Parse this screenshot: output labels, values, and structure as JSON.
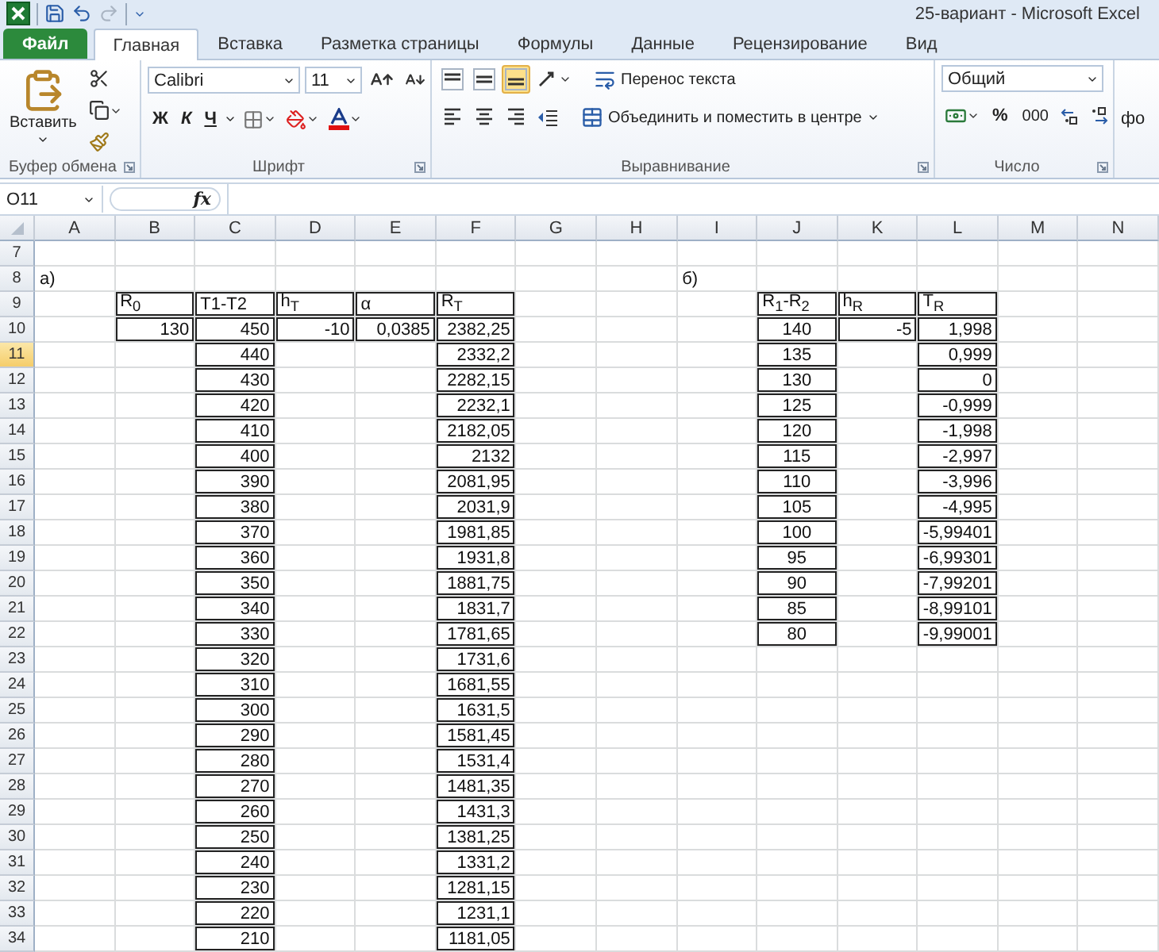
{
  "window": {
    "title": "25-вариант  -  Microsoft Excel"
  },
  "quick_access": [
    {
      "kind": "save",
      "disabled": false
    },
    {
      "kind": "undo",
      "disabled": false
    },
    {
      "kind": "redo",
      "disabled": true
    }
  ],
  "tabs": [
    {
      "label": "Файл",
      "kind": "file",
      "selected": false
    },
    {
      "label": "Главная",
      "kind": "normal",
      "selected": true
    },
    {
      "label": "Вставка",
      "kind": "normal",
      "selected": false
    },
    {
      "label": "Разметка страницы",
      "kind": "normal",
      "selected": false
    },
    {
      "label": "Формулы",
      "kind": "normal",
      "selected": false
    },
    {
      "label": "Данные",
      "kind": "normal",
      "selected": false
    },
    {
      "label": "Рецензирование",
      "kind": "normal",
      "selected": false
    },
    {
      "label": "Вид",
      "kind": "normal",
      "selected": false
    }
  ],
  "ribbon": {
    "clipboard": {
      "paste_label": "Вставить",
      "title": "Буфер обмена"
    },
    "font": {
      "name": "Calibri",
      "size": "11",
      "styles": [
        "Ж",
        "К",
        "Ч"
      ],
      "title": "Шрифт"
    },
    "alignment": {
      "vertical": [
        {
          "kind": "top",
          "selected": false
        },
        {
          "kind": "middle",
          "selected": false
        },
        {
          "kind": "bottom",
          "selected": true
        }
      ],
      "horizontal": [
        {
          "kind": "left",
          "selected": false
        },
        {
          "kind": "center",
          "selected": false
        },
        {
          "kind": "right",
          "selected": false
        }
      ],
      "wrap_label": "Перенос текста",
      "merge_label": "Объединить и поместить в центре",
      "title": "Выравнивание"
    },
    "number": {
      "format": "Общий",
      "percent": "%",
      "thousands": "000",
      "title": "Число"
    },
    "next_group": {
      "label": "фо"
    }
  },
  "formula_bar": {
    "name_box": "O11",
    "function_label": "fx"
  },
  "sheet": {
    "columns": [
      "A",
      "B",
      "C",
      "D",
      "E",
      "F",
      "G",
      "H",
      "I",
      "J",
      "K",
      "L",
      "M",
      "N"
    ],
    "rows": [
      {
        "number": "7",
        "selected": false,
        "cells": [
          {
            "kind": "empty",
            "boxed": false
          },
          {
            "kind": "empty",
            "boxed": false
          },
          {
            "kind": "empty",
            "boxed": false
          },
          {
            "kind": "empty",
            "boxed": false
          },
          {
            "kind": "empty",
            "boxed": false
          },
          {
            "kind": "empty",
            "boxed": false
          },
          {
            "kind": "empty",
            "boxed": false
          },
          {
            "kind": "empty",
            "boxed": false
          },
          {
            "kind": "empty",
            "boxed": false
          },
          {
            "kind": "empty",
            "boxed": false
          },
          {
            "kind": "empty",
            "boxed": false
          },
          {
            "kind": "empty",
            "boxed": false
          },
          {
            "kind": "empty",
            "boxed": false
          },
          {
            "kind": "empty",
            "boxed": false
          }
        ]
      },
      {
        "number": "8",
        "selected": false,
        "cells": [
          {
            "kind": "label",
            "text": "а)",
            "boxed": false
          },
          {
            "kind": "empty",
            "boxed": false
          },
          {
            "kind": "empty",
            "boxed": false
          },
          {
            "kind": "empty",
            "boxed": false
          },
          {
            "kind": "empty",
            "boxed": false
          },
          {
            "kind": "empty",
            "boxed": false
          },
          {
            "kind": "empty",
            "boxed": false
          },
          {
            "kind": "empty",
            "boxed": false
          },
          {
            "kind": "label",
            "text": "б)",
            "boxed": false
          },
          {
            "kind": "empty",
            "boxed": false
          },
          {
            "kind": "empty",
            "boxed": false
          },
          {
            "kind": "empty",
            "boxed": false
          },
          {
            "kind": "empty",
            "boxed": false
          },
          {
            "kind": "empty",
            "boxed": false
          }
        ]
      },
      {
        "number": "9",
        "selected": false,
        "cells": [
          {
            "kind": "empty",
            "boxed": false
          },
          {
            "kind": "label",
            "text": "R$_{0}$",
            "boxed": true
          },
          {
            "kind": "label",
            "text": "T1-T2",
            "boxed": true
          },
          {
            "kind": "label",
            "text": "h$_{T}$",
            "boxed": true
          },
          {
            "kind": "label",
            "text": "α",
            "boxed": true
          },
          {
            "kind": "label",
            "text": "R$_{T}$",
            "boxed": true
          },
          {
            "kind": "empty",
            "boxed": false
          },
          {
            "kind": "empty",
            "boxed": false
          },
          {
            "kind": "empty",
            "boxed": false
          },
          {
            "kind": "label",
            "text": "R$_{1}$-R$_{2}$",
            "boxed": true
          },
          {
            "kind": "label",
            "text": "h$_{R}$",
            "boxed": true
          },
          {
            "kind": "label",
            "text": "T$_{R}$",
            "boxed": true
          },
          {
            "kind": "empty",
            "boxed": false
          },
          {
            "kind": "empty",
            "boxed": false
          }
        ]
      },
      {
        "number": "10",
        "selected": false,
        "cells": [
          {
            "kind": "empty",
            "boxed": false
          },
          {
            "kind": "number",
            "text": "130",
            "boxed": true
          },
          {
            "kind": "number",
            "text": "450",
            "boxed": true
          },
          {
            "kind": "number",
            "text": "-10",
            "boxed": true
          },
          {
            "kind": "number",
            "text": "0,0385",
            "boxed": true
          },
          {
            "kind": "number",
            "text": "2382,25",
            "boxed": true
          },
          {
            "kind": "empty",
            "boxed": false
          },
          {
            "kind": "empty",
            "boxed": false
          },
          {
            "kind": "empty",
            "boxed": false
          },
          {
            "kind": "centered",
            "text": "140",
            "boxed": true
          },
          {
            "kind": "number",
            "text": "-5",
            "boxed": true
          },
          {
            "kind": "number",
            "text": "1,998",
            "boxed": true
          },
          {
            "kind": "empty",
            "boxed": false
          },
          {
            "kind": "empty",
            "boxed": false
          }
        ]
      },
      {
        "number": "11",
        "selected": true,
        "cells": [
          {
            "kind": "empty",
            "boxed": false
          },
          {
            "kind": "empty",
            "boxed": false
          },
          {
            "kind": "number",
            "text": "440",
            "boxed": true
          },
          {
            "kind": "empty",
            "boxed": false
          },
          {
            "kind": "empty",
            "boxed": false
          },
          {
            "kind": "number",
            "text": "2332,2",
            "boxed": true
          },
          {
            "kind": "empty",
            "boxed": false
          },
          {
            "kind": "empty",
            "boxed": false
          },
          {
            "kind": "empty",
            "boxed": false
          },
          {
            "kind": "centered",
            "text": "135",
            "boxed": true
          },
          {
            "kind": "empty",
            "boxed": false
          },
          {
            "kind": "number",
            "text": "0,999",
            "boxed": true
          },
          {
            "kind": "empty",
            "boxed": false
          },
          {
            "kind": "empty",
            "boxed": false
          }
        ]
      },
      {
        "number": "12",
        "selected": false,
        "cells": [
          {
            "kind": "empty",
            "boxed": false
          },
          {
            "kind": "empty",
            "boxed": false
          },
          {
            "kind": "number",
            "text": "430",
            "boxed": true
          },
          {
            "kind": "empty",
            "boxed": false
          },
          {
            "kind": "empty",
            "boxed": false
          },
          {
            "kind": "number",
            "text": "2282,15",
            "boxed": true
          },
          {
            "kind": "empty",
            "boxed": false
          },
          {
            "kind": "empty",
            "boxed": false
          },
          {
            "kind": "empty",
            "boxed": false
          },
          {
            "kind": "centered",
            "text": "130",
            "boxed": true
          },
          {
            "kind": "empty",
            "boxed": false
          },
          {
            "kind": "number",
            "text": "0",
            "boxed": true
          },
          {
            "kind": "empty",
            "boxed": false
          },
          {
            "kind": "empty",
            "boxed": false
          }
        ]
      },
      {
        "number": "13",
        "selected": false,
        "cells": [
          {
            "kind": "empty",
            "boxed": false
          },
          {
            "kind": "empty",
            "boxed": false
          },
          {
            "kind": "number",
            "text": "420",
            "boxed": true
          },
          {
            "kind": "empty",
            "boxed": false
          },
          {
            "kind": "empty",
            "boxed": false
          },
          {
            "kind": "number",
            "text": "2232,1",
            "boxed": true
          },
          {
            "kind": "empty",
            "boxed": false
          },
          {
            "kind": "empty",
            "boxed": false
          },
          {
            "kind": "empty",
            "boxed": false
          },
          {
            "kind": "centered",
            "text": "125",
            "boxed": true
          },
          {
            "kind": "empty",
            "boxed": false
          },
          {
            "kind": "number",
            "text": "-0,999",
            "boxed": true
          },
          {
            "kind": "empty",
            "boxed": false
          },
          {
            "kind": "empty",
            "boxed": false
          }
        ]
      },
      {
        "number": "14",
        "selected": false,
        "cells": [
          {
            "kind": "empty",
            "boxed": false
          },
          {
            "kind": "empty",
            "boxed": false
          },
          {
            "kind": "number",
            "text": "410",
            "boxed": true
          },
          {
            "kind": "empty",
            "boxed": false
          },
          {
            "kind": "empty",
            "boxed": false
          },
          {
            "kind": "number",
            "text": "2182,05",
            "boxed": true
          },
          {
            "kind": "empty",
            "boxed": false
          },
          {
            "kind": "empty",
            "boxed": false
          },
          {
            "kind": "empty",
            "boxed": false
          },
          {
            "kind": "centered",
            "text": "120",
            "boxed": true
          },
          {
            "kind": "empty",
            "boxed": false
          },
          {
            "kind": "number",
            "text": "-1,998",
            "boxed": true
          },
          {
            "kind": "empty",
            "boxed": false
          },
          {
            "kind": "empty",
            "boxed": false
          }
        ]
      },
      {
        "number": "15",
        "selected": false,
        "cells": [
          {
            "kind": "empty",
            "boxed": false
          },
          {
            "kind": "empty",
            "boxed": false
          },
          {
            "kind": "number",
            "text": "400",
            "boxed": true
          },
          {
            "kind": "empty",
            "boxed": false
          },
          {
            "kind": "empty",
            "boxed": false
          },
          {
            "kind": "number",
            "text": "2132",
            "boxed": true
          },
          {
            "kind": "empty",
            "boxed": false
          },
          {
            "kind": "empty",
            "boxed": false
          },
          {
            "kind": "empty",
            "boxed": false
          },
          {
            "kind": "centered",
            "text": "115",
            "boxed": true
          },
          {
            "kind": "empty",
            "boxed": false
          },
          {
            "kind": "number",
            "text": "-2,997",
            "boxed": true
          },
          {
            "kind": "empty",
            "boxed": false
          },
          {
            "kind": "empty",
            "boxed": false
          }
        ]
      },
      {
        "number": "16",
        "selected": false,
        "cells": [
          {
            "kind": "empty",
            "boxed": false
          },
          {
            "kind": "empty",
            "boxed": false
          },
          {
            "kind": "number",
            "text": "390",
            "boxed": true
          },
          {
            "kind": "empty",
            "boxed": false
          },
          {
            "kind": "empty",
            "boxed": false
          },
          {
            "kind": "number",
            "text": "2081,95",
            "boxed": true
          },
          {
            "kind": "empty",
            "boxed": false
          },
          {
            "kind": "empty",
            "boxed": false
          },
          {
            "kind": "empty",
            "boxed": false
          },
          {
            "kind": "centered",
            "text": "110",
            "boxed": true
          },
          {
            "kind": "empty",
            "boxed": false
          },
          {
            "kind": "number",
            "text": "-3,996",
            "boxed": true
          },
          {
            "kind": "empty",
            "boxed": false
          },
          {
            "kind": "empty",
            "boxed": false
          }
        ]
      },
      {
        "number": "17",
        "selected": false,
        "cells": [
          {
            "kind": "empty",
            "boxed": false
          },
          {
            "kind": "empty",
            "boxed": false
          },
          {
            "kind": "number",
            "text": "380",
            "boxed": true
          },
          {
            "kind": "empty",
            "boxed": false
          },
          {
            "kind": "empty",
            "boxed": false
          },
          {
            "kind": "number",
            "text": "2031,9",
            "boxed": true
          },
          {
            "kind": "empty",
            "boxed": false
          },
          {
            "kind": "empty",
            "boxed": false
          },
          {
            "kind": "empty",
            "boxed": false
          },
          {
            "kind": "centered",
            "text": "105",
            "boxed": true
          },
          {
            "kind": "empty",
            "boxed": false
          },
          {
            "kind": "number",
            "text": "-4,995",
            "boxed": true
          },
          {
            "kind": "empty",
            "boxed": false
          },
          {
            "kind": "empty",
            "boxed": false
          }
        ]
      },
      {
        "number": "18",
        "selected": false,
        "cells": [
          {
            "kind": "empty",
            "boxed": false
          },
          {
            "kind": "empty",
            "boxed": false
          },
          {
            "kind": "number",
            "text": "370",
            "boxed": true
          },
          {
            "kind": "empty",
            "boxed": false
          },
          {
            "kind": "empty",
            "boxed": false
          },
          {
            "kind": "number",
            "text": "1981,85",
            "boxed": true
          },
          {
            "kind": "empty",
            "boxed": false
          },
          {
            "kind": "empty",
            "boxed": false
          },
          {
            "kind": "empty",
            "boxed": false
          },
          {
            "kind": "centered",
            "text": "100",
            "boxed": true
          },
          {
            "kind": "empty",
            "boxed": false
          },
          {
            "kind": "number",
            "text": "-5,99401",
            "boxed": true
          },
          {
            "kind": "empty",
            "boxed": false
          },
          {
            "kind": "empty",
            "boxed": false
          }
        ]
      },
      {
        "number": "19",
        "selected": false,
        "cells": [
          {
            "kind": "empty",
            "boxed": false
          },
          {
            "kind": "empty",
            "boxed": false
          },
          {
            "kind": "number",
            "text": "360",
            "boxed": true
          },
          {
            "kind": "empty",
            "boxed": false
          },
          {
            "kind": "empty",
            "boxed": false
          },
          {
            "kind": "number",
            "text": "1931,8",
            "boxed": true
          },
          {
            "kind": "empty",
            "boxed": false
          },
          {
            "kind": "empty",
            "boxed": false
          },
          {
            "kind": "empty",
            "boxed": false
          },
          {
            "kind": "centered",
            "text": "95",
            "boxed": true
          },
          {
            "kind": "empty",
            "boxed": false
          },
          {
            "kind": "number",
            "text": "-6,99301",
            "boxed": true
          },
          {
            "kind": "empty",
            "boxed": false
          },
          {
            "kind": "empty",
            "boxed": false
          }
        ]
      },
      {
        "number": "20",
        "selected": false,
        "cells": [
          {
            "kind": "empty",
            "boxed": false
          },
          {
            "kind": "empty",
            "boxed": false
          },
          {
            "kind": "number",
            "text": "350",
            "boxed": true
          },
          {
            "kind": "empty",
            "boxed": false
          },
          {
            "kind": "empty",
            "boxed": false
          },
          {
            "kind": "number",
            "text": "1881,75",
            "boxed": true
          },
          {
            "kind": "empty",
            "boxed": false
          },
          {
            "kind": "empty",
            "boxed": false
          },
          {
            "kind": "empty",
            "boxed": false
          },
          {
            "kind": "centered",
            "text": "90",
            "boxed": true
          },
          {
            "kind": "empty",
            "boxed": false
          },
          {
            "kind": "number",
            "text": "-7,99201",
            "boxed": true
          },
          {
            "kind": "empty",
            "boxed": false
          },
          {
            "kind": "empty",
            "boxed": false
          }
        ]
      },
      {
        "number": "21",
        "selected": false,
        "cells": [
          {
            "kind": "empty",
            "boxed": false
          },
          {
            "kind": "empty",
            "boxed": false
          },
          {
            "kind": "number",
            "text": "340",
            "boxed": true
          },
          {
            "kind": "empty",
            "boxed": false
          },
          {
            "kind": "empty",
            "boxed": false
          },
          {
            "kind": "number",
            "text": "1831,7",
            "boxed": true
          },
          {
            "kind": "empty",
            "boxed": false
          },
          {
            "kind": "empty",
            "boxed": false
          },
          {
            "kind": "empty",
            "boxed": false
          },
          {
            "kind": "centered",
            "text": "85",
            "boxed": true
          },
          {
            "kind": "empty",
            "boxed": false
          },
          {
            "kind": "number",
            "text": "-8,99101",
            "boxed": true
          },
          {
            "kind": "empty",
            "boxed": false
          },
          {
            "kind": "empty",
            "boxed": false
          }
        ]
      },
      {
        "number": "22",
        "selected": false,
        "cells": [
          {
            "kind": "empty",
            "boxed": false
          },
          {
            "kind": "empty",
            "boxed": false
          },
          {
            "kind": "number",
            "text": "330",
            "boxed": true
          },
          {
            "kind": "empty",
            "boxed": false
          },
          {
            "kind": "empty",
            "boxed": false
          },
          {
            "kind": "number",
            "text": "1781,65",
            "boxed": true
          },
          {
            "kind": "empty",
            "boxed": false
          },
          {
            "kind": "empty",
            "boxed": false
          },
          {
            "kind": "empty",
            "boxed": false
          },
          {
            "kind": "centered",
            "text": "80",
            "boxed": true
          },
          {
            "kind": "empty",
            "boxed": false
          },
          {
            "kind": "number",
            "text": "-9,99001",
            "boxed": true
          },
          {
            "kind": "empty",
            "boxed": false
          },
          {
            "kind": "empty",
            "boxed": false
          }
        ]
      },
      {
        "number": "23",
        "selected": false,
        "cells": [
          {
            "kind": "empty",
            "boxed": false
          },
          {
            "kind": "empty",
            "boxed": false
          },
          {
            "kind": "number",
            "text": "320",
            "boxed": true
          },
          {
            "kind": "empty",
            "boxed": false
          },
          {
            "kind": "empty",
            "boxed": false
          },
          {
            "kind": "number",
            "text": "1731,6",
            "boxed": true
          },
          {
            "kind": "empty",
            "boxed": false
          },
          {
            "kind": "empty",
            "boxed": false
          },
          {
            "kind": "empty",
            "boxed": false
          },
          {
            "kind": "empty",
            "boxed": false
          },
          {
            "kind": "empty",
            "boxed": false
          },
          {
            "kind": "empty",
            "boxed": false
          },
          {
            "kind": "empty",
            "boxed": false
          },
          {
            "kind": "empty",
            "boxed": false
          }
        ]
      },
      {
        "number": "24",
        "selected": false,
        "cells": [
          {
            "kind": "empty",
            "boxed": false
          },
          {
            "kind": "empty",
            "boxed": false
          },
          {
            "kind": "number",
            "text": "310",
            "boxed": true
          },
          {
            "kind": "empty",
            "boxed": false
          },
          {
            "kind": "empty",
            "boxed": false
          },
          {
            "kind": "number",
            "text": "1681,55",
            "boxed": true
          },
          {
            "kind": "empty",
            "boxed": false
          },
          {
            "kind": "empty",
            "boxed": false
          },
          {
            "kind": "empty",
            "boxed": false
          },
          {
            "kind": "empty",
            "boxed": false
          },
          {
            "kind": "empty",
            "boxed": false
          },
          {
            "kind": "empty",
            "boxed": false
          },
          {
            "kind": "empty",
            "boxed": false
          },
          {
            "kind": "empty",
            "boxed": false
          }
        ]
      },
      {
        "number": "25",
        "selected": false,
        "cells": [
          {
            "kind": "empty",
            "boxed": false
          },
          {
            "kind": "empty",
            "boxed": false
          },
          {
            "kind": "number",
            "text": "300",
            "boxed": true
          },
          {
            "kind": "empty",
            "boxed": false
          },
          {
            "kind": "empty",
            "boxed": false
          },
          {
            "kind": "number",
            "text": "1631,5",
            "boxed": true
          },
          {
            "kind": "empty",
            "boxed": false
          },
          {
            "kind": "empty",
            "boxed": false
          },
          {
            "kind": "empty",
            "boxed": false
          },
          {
            "kind": "empty",
            "boxed": false
          },
          {
            "kind": "empty",
            "boxed": false
          },
          {
            "kind": "empty",
            "boxed": false
          },
          {
            "kind": "empty",
            "boxed": false
          },
          {
            "kind": "empty",
            "boxed": false
          }
        ]
      },
      {
        "number": "26",
        "selected": false,
        "cells": [
          {
            "kind": "empty",
            "boxed": false
          },
          {
            "kind": "empty",
            "boxed": false
          },
          {
            "kind": "number",
            "text": "290",
            "boxed": true
          },
          {
            "kind": "empty",
            "boxed": false
          },
          {
            "kind": "empty",
            "boxed": false
          },
          {
            "kind": "number",
            "text": "1581,45",
            "boxed": true
          },
          {
            "kind": "empty",
            "boxed": false
          },
          {
            "kind": "empty",
            "boxed": false
          },
          {
            "kind": "empty",
            "boxed": false
          },
          {
            "kind": "empty",
            "boxed": false
          },
          {
            "kind": "empty",
            "boxed": false
          },
          {
            "kind": "empty",
            "boxed": false
          },
          {
            "kind": "empty",
            "boxed": false
          },
          {
            "kind": "empty",
            "boxed": false
          }
        ]
      },
      {
        "number": "27",
        "selected": false,
        "cells": [
          {
            "kind": "empty",
            "boxed": false
          },
          {
            "kind": "empty",
            "boxed": false
          },
          {
            "kind": "number",
            "text": "280",
            "boxed": true
          },
          {
            "kind": "empty",
            "boxed": false
          },
          {
            "kind": "empty",
            "boxed": false
          },
          {
            "kind": "number",
            "text": "1531,4",
            "boxed": true
          },
          {
            "kind": "empty",
            "boxed": false
          },
          {
            "kind": "empty",
            "boxed": false
          },
          {
            "kind": "empty",
            "boxed": false
          },
          {
            "kind": "empty",
            "boxed": false
          },
          {
            "kind": "empty",
            "boxed": false
          },
          {
            "kind": "empty",
            "boxed": false
          },
          {
            "kind": "empty",
            "boxed": false
          },
          {
            "kind": "empty",
            "boxed": false
          }
        ]
      },
      {
        "number": "28",
        "selected": false,
        "cells": [
          {
            "kind": "empty",
            "boxed": false
          },
          {
            "kind": "empty",
            "boxed": false
          },
          {
            "kind": "number",
            "text": "270",
            "boxed": true
          },
          {
            "kind": "empty",
            "boxed": false
          },
          {
            "kind": "empty",
            "boxed": false
          },
          {
            "kind": "number",
            "text": "1481,35",
            "boxed": true
          },
          {
            "kind": "empty",
            "boxed": false
          },
          {
            "kind": "empty",
            "boxed": false
          },
          {
            "kind": "empty",
            "boxed": false
          },
          {
            "kind": "empty",
            "boxed": false
          },
          {
            "kind": "empty",
            "boxed": false
          },
          {
            "kind": "empty",
            "boxed": false
          },
          {
            "kind": "empty",
            "boxed": false
          },
          {
            "kind": "empty",
            "boxed": false
          }
        ]
      },
      {
        "number": "29",
        "selected": false,
        "cells": [
          {
            "kind": "empty",
            "boxed": false
          },
          {
            "kind": "empty",
            "boxed": false
          },
          {
            "kind": "number",
            "text": "260",
            "boxed": true
          },
          {
            "kind": "empty",
            "boxed": false
          },
          {
            "kind": "empty",
            "boxed": false
          },
          {
            "kind": "number",
            "text": "1431,3",
            "boxed": true
          },
          {
            "kind": "empty",
            "boxed": false
          },
          {
            "kind": "empty",
            "boxed": false
          },
          {
            "kind": "empty",
            "boxed": false
          },
          {
            "kind": "empty",
            "boxed": false
          },
          {
            "kind": "empty",
            "boxed": false
          },
          {
            "kind": "empty",
            "boxed": false
          },
          {
            "kind": "empty",
            "boxed": false
          },
          {
            "kind": "empty",
            "boxed": false
          }
        ]
      },
      {
        "number": "30",
        "selected": false,
        "cells": [
          {
            "kind": "empty",
            "boxed": false
          },
          {
            "kind": "empty",
            "boxed": false
          },
          {
            "kind": "number",
            "text": "250",
            "boxed": true
          },
          {
            "kind": "empty",
            "boxed": false
          },
          {
            "kind": "empty",
            "boxed": false
          },
          {
            "kind": "number",
            "text": "1381,25",
            "boxed": true
          },
          {
            "kind": "empty",
            "boxed": false
          },
          {
            "kind": "empty",
            "boxed": false
          },
          {
            "kind": "empty",
            "boxed": false
          },
          {
            "kind": "empty",
            "boxed": false
          },
          {
            "kind": "empty",
            "boxed": false
          },
          {
            "kind": "empty",
            "boxed": false
          },
          {
            "kind": "empty",
            "boxed": false
          },
          {
            "kind": "empty",
            "boxed": false
          }
        ]
      },
      {
        "number": "31",
        "selected": false,
        "cells": [
          {
            "kind": "empty",
            "boxed": false
          },
          {
            "kind": "empty",
            "boxed": false
          },
          {
            "kind": "number",
            "text": "240",
            "boxed": true
          },
          {
            "kind": "empty",
            "boxed": false
          },
          {
            "kind": "empty",
            "boxed": false
          },
          {
            "kind": "number",
            "text": "1331,2",
            "boxed": true
          },
          {
            "kind": "empty",
            "boxed": false
          },
          {
            "kind": "empty",
            "boxed": false
          },
          {
            "kind": "empty",
            "boxed": false
          },
          {
            "kind": "empty",
            "boxed": false
          },
          {
            "kind": "empty",
            "boxed": false
          },
          {
            "kind": "empty",
            "boxed": false
          },
          {
            "kind": "empty",
            "boxed": false
          },
          {
            "kind": "empty",
            "boxed": false
          }
        ]
      },
      {
        "number": "32",
        "selected": false,
        "cells": [
          {
            "kind": "empty",
            "boxed": false
          },
          {
            "kind": "empty",
            "boxed": false
          },
          {
            "kind": "number",
            "text": "230",
            "boxed": true
          },
          {
            "kind": "empty",
            "boxed": false
          },
          {
            "kind": "empty",
            "boxed": false
          },
          {
            "kind": "number",
            "text": "1281,15",
            "boxed": true
          },
          {
            "kind": "empty",
            "boxed": false
          },
          {
            "kind": "empty",
            "boxed": false
          },
          {
            "kind": "empty",
            "boxed": false
          },
          {
            "kind": "empty",
            "boxed": false
          },
          {
            "kind": "empty",
            "boxed": false
          },
          {
            "kind": "empty",
            "boxed": false
          },
          {
            "kind": "empty",
            "boxed": false
          },
          {
            "kind": "empty",
            "boxed": false
          }
        ]
      },
      {
        "number": "33",
        "selected": false,
        "cells": [
          {
            "kind": "empty",
            "boxed": false
          },
          {
            "kind": "empty",
            "boxed": false
          },
          {
            "kind": "number",
            "text": "220",
            "boxed": true
          },
          {
            "kind": "empty",
            "boxed": false
          },
          {
            "kind": "empty",
            "boxed": false
          },
          {
            "kind": "number",
            "text": "1231,1",
            "boxed": true
          },
          {
            "kind": "empty",
            "boxed": false
          },
          {
            "kind": "empty",
            "boxed": false
          },
          {
            "kind": "empty",
            "boxed": false
          },
          {
            "kind": "empty",
            "boxed": false
          },
          {
            "kind": "empty",
            "boxed": false
          },
          {
            "kind": "empty",
            "boxed": false
          },
          {
            "kind": "empty",
            "boxed": false
          },
          {
            "kind": "empty",
            "boxed": false
          }
        ]
      },
      {
        "number": "34",
        "selected": false,
        "cells": [
          {
            "kind": "empty",
            "boxed": false
          },
          {
            "kind": "empty",
            "boxed": false
          },
          {
            "kind": "number",
            "text": "210",
            "boxed": true
          },
          {
            "kind": "empty",
            "boxed": false
          },
          {
            "kind": "empty",
            "boxed": false
          },
          {
            "kind": "number",
            "text": "1181,05",
            "boxed": true
          },
          {
            "kind": "empty",
            "boxed": false
          },
          {
            "kind": "empty",
            "boxed": false
          },
          {
            "kind": "empty",
            "boxed": false
          },
          {
            "kind": "empty",
            "boxed": false
          },
          {
            "kind": "empty",
            "boxed": false
          },
          {
            "kind": "empty",
            "boxed": false
          },
          {
            "kind": "empty",
            "boxed": false
          },
          {
            "kind": "empty",
            "boxed": false
          }
        ]
      }
    ]
  }
}
